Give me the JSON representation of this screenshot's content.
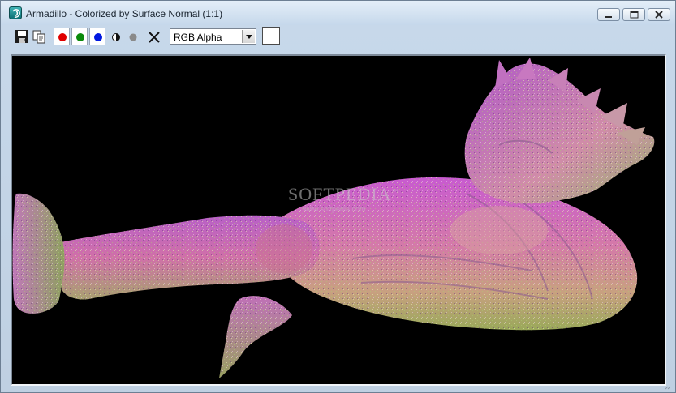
{
  "window": {
    "title": "Armadillo - Colorized by Surface Normal (1:1)",
    "icons": {
      "app": "3dsmax-app-icon",
      "minimize": "minimize-icon",
      "maximize": "maximize-icon",
      "close": "close-icon"
    }
  },
  "toolbar": {
    "icons": [
      "save-icon",
      "copy-icon",
      "red-channel-icon",
      "green-channel-icon",
      "blue-channel-icon",
      "mono-icon",
      "alpha-icon",
      "clear-icon"
    ],
    "channel_colors": {
      "red": "#e00000",
      "green": "#0a8a0a",
      "blue": "#0018e0"
    },
    "display_select": {
      "value": "RGB Alpha"
    },
    "swatch_color": "#ffffff"
  },
  "viewport": {
    "background": "#000000",
    "watermark": "SOFTPEDIA",
    "watermark_mark": "™",
    "watermark_sub": "www.softpedia.com",
    "subject": "armadillo-render"
  }
}
